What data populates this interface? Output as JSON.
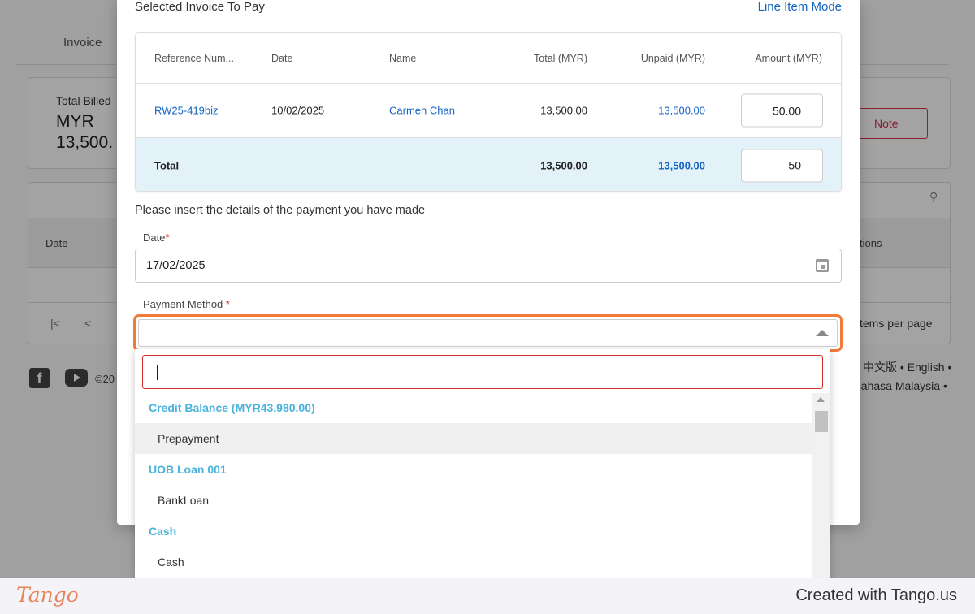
{
  "background": {
    "tab_invoice": "Invoice",
    "total_billed_label": "Total Billed",
    "total_billed_currency": "MYR",
    "total_billed_amount": "13,500.",
    "note_button": "Note",
    "column_date": "Date",
    "column_actions": "tions",
    "pager_first": "|<",
    "pager_prev": "<",
    "items_per_page": "tems per page",
    "copyright": "©20",
    "languages_line1": "中文版 • English •",
    "languages_line2": "3ahasa Malaysia •"
  },
  "modal": {
    "title": "Selected Invoice To Pay",
    "mode_link": "Line Item Mode",
    "table": {
      "headers": {
        "reference": "Reference Num...",
        "date": "Date",
        "name": "Name",
        "total": "Total (MYR)",
        "unpaid": "Unpaid (MYR)",
        "amount": "Amount (MYR)"
      },
      "row": {
        "reference": "RW25-419biz",
        "date": "10/02/2025",
        "name": "Carmen Chan",
        "total": "13,500.00",
        "unpaid": "13,500.00",
        "amount": "50.00"
      },
      "total_row": {
        "label": "Total",
        "total": "13,500.00",
        "unpaid": "13,500.00",
        "amount": "50"
      }
    },
    "instructions": "Please insert the details of the payment you have made",
    "date_field": {
      "label": "Date",
      "required_mark": "*",
      "value": "17/02/2025"
    },
    "payment_method": {
      "label": "Payment Method ",
      "required_mark": "*",
      "value": ""
    }
  },
  "dropdown": {
    "search_value": "",
    "groups": [
      {
        "label": "Credit Balance (MYR43,980.00)",
        "options": [
          "Prepayment"
        ]
      },
      {
        "label": "UOB Loan 001",
        "options": [
          "BankLoan"
        ]
      },
      {
        "label": "Cash",
        "options": [
          "Cash"
        ]
      }
    ],
    "hovered_option": "Prepayment"
  },
  "footer": {
    "logo": "Tango",
    "credit": "Created with Tango.us"
  },
  "colors": {
    "link_blue": "#1565c0",
    "group_blue": "#4ab3dc",
    "focus_orange": "#f07b3a",
    "error_red": "#d32f2f",
    "total_row_bg": "#e3f1f9",
    "tango_orange": "#e8845a"
  }
}
